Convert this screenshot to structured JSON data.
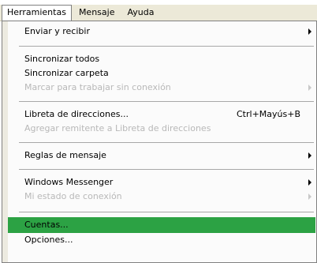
{
  "menubar": {
    "items": [
      {
        "label": "Herramientas"
      },
      {
        "label": "Mensaje"
      },
      {
        "label": "Ayuda"
      }
    ]
  },
  "menu": {
    "items": [
      {
        "label": "Enviar y recibir",
        "submenu": true
      },
      {
        "label": "Sincronizar todos"
      },
      {
        "label": "Sincronizar carpeta"
      },
      {
        "label": "Marcar para trabajar sin conexión",
        "disabled": true,
        "submenu": true
      },
      {
        "label": "Libreta de direcciones...",
        "shortcut": "Ctrl+Mayús+B"
      },
      {
        "label": "Agregar remitente a Libreta de direcciones",
        "disabled": true
      },
      {
        "label": "Reglas de mensaje",
        "submenu": true
      },
      {
        "label": "Windows Messenger",
        "submenu": true
      },
      {
        "label": "Mi estado de conexión",
        "disabled": true,
        "submenu": true
      },
      {
        "label": "Cuentas...",
        "highlighted": true
      },
      {
        "label": "Opciones..."
      }
    ],
    "highlight_color": "#2ca244"
  }
}
